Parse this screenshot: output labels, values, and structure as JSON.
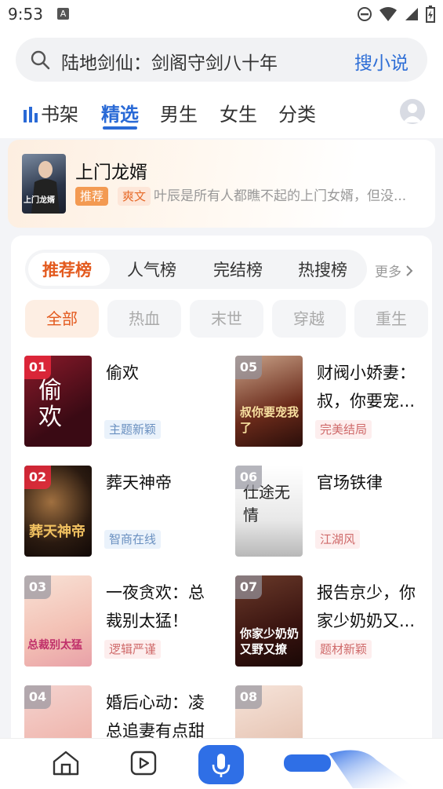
{
  "status": {
    "time": "9:53",
    "notif_letter": "A"
  },
  "search": {
    "text": "陆地剑仙：剑阁守剑八十年",
    "button": "搜小说"
  },
  "tabs": [
    {
      "label": "书架"
    },
    {
      "label": "精选"
    },
    {
      "label": "男生"
    },
    {
      "label": "女生"
    },
    {
      "label": "分类"
    }
  ],
  "feature": {
    "title": "上门龙婿",
    "badge_recommend": "推荐",
    "badge_genre": "爽文",
    "desc": "叶辰是所有人都瞧不起的上门女婿，但没...",
    "cover_text": "上门龙婿"
  },
  "ranking": {
    "tabs": [
      "推荐榜",
      "人气榜",
      "完结榜",
      "热搜榜"
    ],
    "more": "更多",
    "filters": [
      "全部",
      "热血",
      "末世",
      "穿越",
      "重生"
    ],
    "books": [
      {
        "rank": "01",
        "title": "偷欢",
        "tag": "主题新颖",
        "cover_text": "偷欢"
      },
      {
        "rank": "02",
        "title": "葬天神帝",
        "tag": "智商在线",
        "cover_text": "葬天神帝"
      },
      {
        "rank": "03",
        "title": "一夜贪欢：总裁别太猛！",
        "tag": "逻辑严谨",
        "cover_text": "总裁别太猛"
      },
      {
        "rank": "04",
        "title": "婚后心动：凌总追妻有点甜",
        "tag": "",
        "cover_text": ""
      },
      {
        "rank": "05",
        "title": "财阀小娇妻：叔，你要宠...",
        "tag": "完美结局",
        "cover_text": "叔你要宠我了"
      },
      {
        "rank": "06",
        "title": "官场铁律",
        "tag": "江湖风",
        "cover_text": "仕途无情"
      },
      {
        "rank": "07",
        "title": "报告京少，你家少奶奶又...",
        "tag": "题材新颖",
        "cover_text": "你家少奶奶又野又撩"
      },
      {
        "rank": "08",
        "title": "",
        "tag": "",
        "cover_text": ""
      }
    ]
  },
  "colors": {
    "accent_blue": "#2a6ad6",
    "accent_orange": "#e35a1e",
    "rank_red": "#eb283c"
  }
}
